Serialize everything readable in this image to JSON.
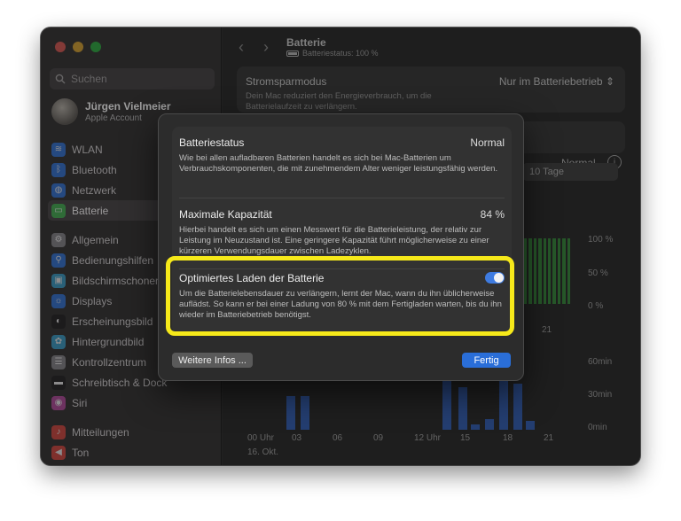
{
  "sidebar": {
    "search_placeholder": "Suchen",
    "account": {
      "name": "Jürgen Vielmeier",
      "subtitle": "Apple Account"
    },
    "items": [
      {
        "label": "WLAN",
        "icon": "wifi-icon",
        "color": "#2f78e8"
      },
      {
        "label": "Bluetooth",
        "icon": "bluetooth-icon",
        "color": "#2f78e8"
      },
      {
        "label": "Netzwerk",
        "icon": "globe-icon",
        "color": "#2f78e8"
      },
      {
        "label": "Batterie",
        "icon": "battery-icon",
        "color": "#39b54a"
      },
      {
        "label": "Allgemein",
        "icon": "gear-icon",
        "color": "#8e8e93"
      },
      {
        "label": "Bedienungshilfen",
        "icon": "accessibility-icon",
        "color": "#2f78e8"
      },
      {
        "label": "Bildschirmschoner",
        "icon": "screensaver-icon",
        "color": "#36a8d8"
      },
      {
        "label": "Displays",
        "icon": "sun-icon",
        "color": "#2f78e8"
      },
      {
        "label": "Erscheinungsbild",
        "icon": "appearance-icon",
        "color": "#1c1c1e"
      },
      {
        "label": "Hintergrundbild",
        "icon": "wallpaper-icon",
        "color": "#36a8d8"
      },
      {
        "label": "Kontrollzentrum",
        "icon": "control-center-icon",
        "color": "#8e8e93"
      },
      {
        "label": "Schreibtisch & Dock",
        "icon": "dock-icon",
        "color": "#1c1c1e"
      },
      {
        "label": "Siri",
        "icon": "siri-icon",
        "color": "#c04aa8"
      },
      {
        "label": "Mitteilungen",
        "icon": "bell-icon",
        "color": "#e5463c"
      },
      {
        "label": "Ton",
        "icon": "speaker-icon",
        "color": "#e5463c"
      }
    ]
  },
  "toolbar": {
    "title": "Batterie",
    "subtitle": "Batteriestatus: 100 %"
  },
  "background": {
    "power_mode_title": "Stromsparmodus",
    "power_mode_desc": "Dein Mac reduziert den Energieverbrauch, um die Batterielaufzeit zu verlängern.",
    "power_mode_value": "Nur im Batteriebetrieb",
    "health_value": "Normal",
    "range_option": "10 Tage",
    "level_axis": [
      "100 %",
      "50 %",
      "0 %"
    ],
    "level_day_label": "21",
    "usage_axis": [
      "60min",
      "30min",
      "0min"
    ],
    "time_labels": [
      "00 Uhr",
      "03",
      "06",
      "09",
      "12 Uhr",
      "15",
      "18",
      "21"
    ],
    "date_label": "16. Okt."
  },
  "dialog": {
    "rows": [
      {
        "title": "Batteriestatus",
        "value": "Normal",
        "desc": "Wie bei allen aufladbaren Batterien handelt es sich bei Mac-Batterien um Verbrauchskomponenten, die mit zunehmendem Alter weniger leistungsfähig werden."
      },
      {
        "title": "Maximale Kapazität",
        "value": "84 %",
        "desc": "Hierbei handelt es sich um einen Messwert für die Batterieleistung, der relativ zur Leistung im Neuzustand ist. Eine geringere Kapazität führt möglicherweise zu einer kürzeren Verwendungsdauer zwischen Ladezyklen."
      },
      {
        "title": "Optimiertes Laden der Batterie",
        "toggle_on": true,
        "desc": "Um die Batterielebensdauer zu verlängern, lernt der Mac, wann du ihn üblicherweise auflädst. So kann er bei einer Ladung von 80 % mit dem Fertigladen warten, bis du ihn wieder im Batteriebetrieb benötigst."
      }
    ],
    "more_info_label": "Weitere Infos ...",
    "done_label": "Fertig"
  },
  "colors": {
    "accent": "#2a6ed8",
    "highlight": "#f6e91a",
    "level_bar": "#2f6b32",
    "usage_bar": "#2c4c8a"
  }
}
